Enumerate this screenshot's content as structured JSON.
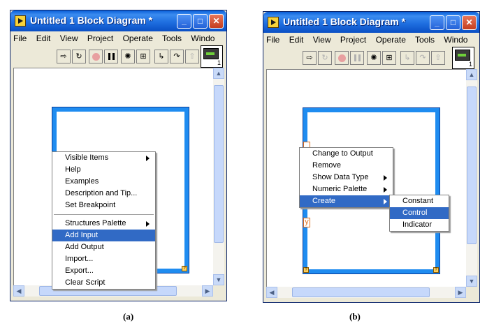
{
  "window_a": {
    "title": "Untitled 1 Block Diagram *",
    "menus": [
      "File",
      "Edit",
      "View",
      "Project",
      "Operate",
      "Tools",
      "Windo"
    ],
    "vi_icon_number": "1",
    "context_menu": {
      "group1": [
        "Visible Items",
        "Help",
        "Examples",
        "Description and Tip...",
        "Set Breakpoint"
      ],
      "group2": [
        "Structures Palette",
        "Add Input",
        "Add Output",
        "Import...",
        "Export...",
        "Clear Script"
      ],
      "selected": "Add Input"
    },
    "caption": "(a)"
  },
  "window_b": {
    "title": "Untitled 1 Block Diagram *",
    "menus": [
      "File",
      "Edit",
      "View",
      "Project",
      "Operate",
      "Tools",
      "Windo"
    ],
    "vi_icon_number": "1",
    "terminal_label": "y",
    "context_menu": {
      "items": [
        "Change to Output",
        "Remove",
        "Show Data Type",
        "Numeric Palette",
        "Create"
      ],
      "selected": "Create"
    },
    "submenu": {
      "items": [
        "Constant",
        "Control",
        "Indicator"
      ],
      "selected": "Control"
    },
    "caption": "(b)"
  },
  "colors": {
    "titlebar": "#0a5fd8",
    "frame": "#1f8cf0",
    "selection": "#316ac5",
    "close": "#c43d1f"
  },
  "icons": [
    "run-arrow-icon",
    "run-continuous-icon",
    "abort-icon",
    "pause-icon",
    "highlight-bulb-icon",
    "retain-wire-icon",
    "step-into-icon",
    "step-over-icon",
    "step-out-icon"
  ]
}
